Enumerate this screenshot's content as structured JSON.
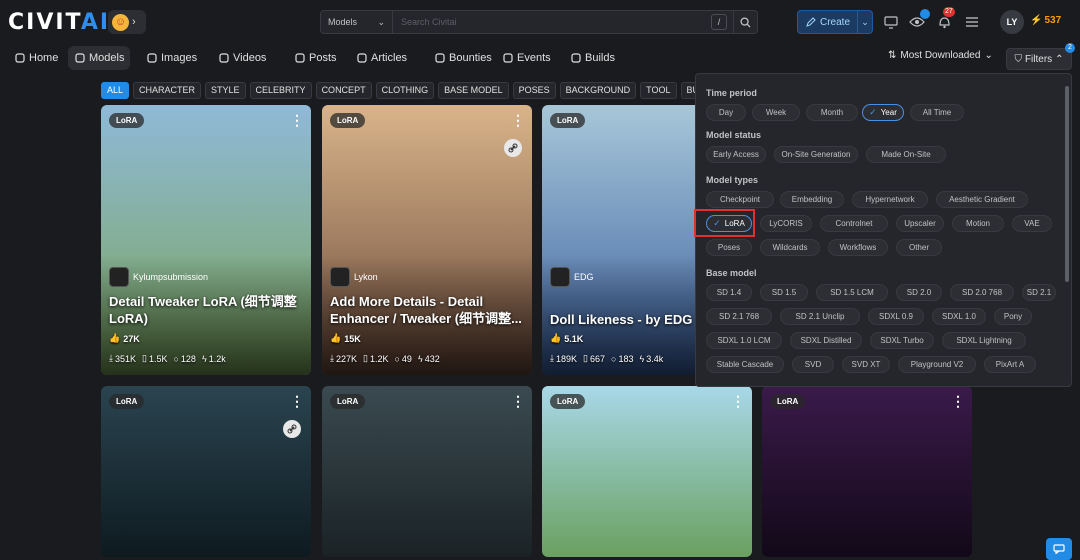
{
  "app": {
    "logo_main": "CIVIT",
    "logo_accent": "AI"
  },
  "search": {
    "scope": "Models",
    "placeholder": "Search Civitai",
    "shortcut": "/"
  },
  "header": {
    "create_label": "Create",
    "notifications_count": "27",
    "upload_badge": "",
    "avatar_initials": "LY",
    "buzz_amount": "537"
  },
  "nav": {
    "items": [
      {
        "label": "Home",
        "icon": "home-icon"
      },
      {
        "label": "Models",
        "icon": "models-icon"
      },
      {
        "label": "Images",
        "icon": "image-icon"
      },
      {
        "label": "Videos",
        "icon": "video-icon"
      },
      {
        "label": "Posts",
        "icon": "posts-icon"
      },
      {
        "label": "Articles",
        "icon": "article-icon"
      },
      {
        "label": "Bounties",
        "icon": "bounty-icon"
      },
      {
        "label": "Events",
        "icon": "calendar-icon"
      },
      {
        "label": "Builds",
        "icon": "builds-icon"
      }
    ],
    "sort_label": "Most Downloaded",
    "filters_label": "Filters",
    "filters_count": "2"
  },
  "categories": [
    "ALL",
    "CHARACTER",
    "STYLE",
    "CELEBRITY",
    "CONCEPT",
    "CLOTHING",
    "BASE MODEL",
    "POSES",
    "BACKGROUND",
    "TOOL",
    "BUILDIN"
  ],
  "cards": [
    {
      "type": "LoRA",
      "creator": "Kylumpsubmission",
      "title": "Detail Tweaker LoRA (细节调整 LoRA)",
      "thumbs": "27K",
      "downloads": "351K",
      "saves": "1.5K",
      "comments": "128",
      "buzz": "1.2k",
      "colors": [
        "#8fb9d8",
        "#7aa55a"
      ]
    },
    {
      "type": "LoRA",
      "creator": "Lykon",
      "title": "Add More Details - Detail Enhancer / Tweaker (细节调整...",
      "thumbs": "15K",
      "downloads": "227K",
      "saves": "1.2K",
      "comments": "49",
      "buzz": "432",
      "colors": [
        "#d9b48a",
        "#6b4a3a"
      ]
    },
    {
      "type": "LoRA",
      "creator": "EDG",
      "title": "Doll Likeness - by EDG",
      "thumbs": "5.1K",
      "downloads": "189K",
      "saves": "667",
      "comments": "183",
      "buzz": "3.4k",
      "colors": [
        "#a7c7d8",
        "#3a5fa0"
      ]
    },
    {
      "type": "LoRA",
      "colors": [
        "#2a4450",
        "#0e1a20"
      ]
    },
    {
      "type": "LoRA",
      "colors": [
        "#3a4a50",
        "#1a2225"
      ]
    },
    {
      "type": "LoRA",
      "colors": [
        "#a8d8e8",
        "#6aa060"
      ]
    },
    {
      "type": "LoRA",
      "colors": [
        "#3a1a4a",
        "#120818"
      ]
    }
  ],
  "filters": {
    "time_period": {
      "title": "Time period",
      "options": [
        "Day",
        "Week",
        "Month",
        "Year",
        "All Time"
      ],
      "selected": "Year"
    },
    "model_status": {
      "title": "Model status",
      "options": [
        "Early Access",
        "On-Site Generation",
        "Made On-Site"
      ]
    },
    "model_types": {
      "title": "Model types",
      "options": [
        "Checkpoint",
        "Embedding",
        "Hypernetwork",
        "Aesthetic Gradient",
        "LoRA",
        "LyCORIS",
        "Controlnet",
        "Upscaler",
        "Motion",
        "VAE",
        "Poses",
        "Wildcards",
        "Workflows",
        "Other"
      ],
      "selected": "LoRA"
    },
    "base_model": {
      "title": "Base model",
      "options": [
        "SD 1.4",
        "SD 1.5",
        "SD 1.5 LCM",
        "SD 2.0",
        "SD 2.0 768",
        "SD 2.1",
        "SD 2.1 768",
        "SD 2.1 Unclip",
        "SDXL 0.9",
        "SDXL 1.0",
        "Pony",
        "SDXL 1.0 LCM",
        "SDXL Distilled",
        "SDXL Turbo",
        "SDXL Lightning",
        "Stable Cascade",
        "SVD",
        "SVD XT",
        "Playground V2",
        "PixArt A"
      ]
    }
  },
  "colors": {
    "accent": "#228be6",
    "highlight": "#e03131",
    "buzz": "#f59f00",
    "notif": "#e03131"
  }
}
